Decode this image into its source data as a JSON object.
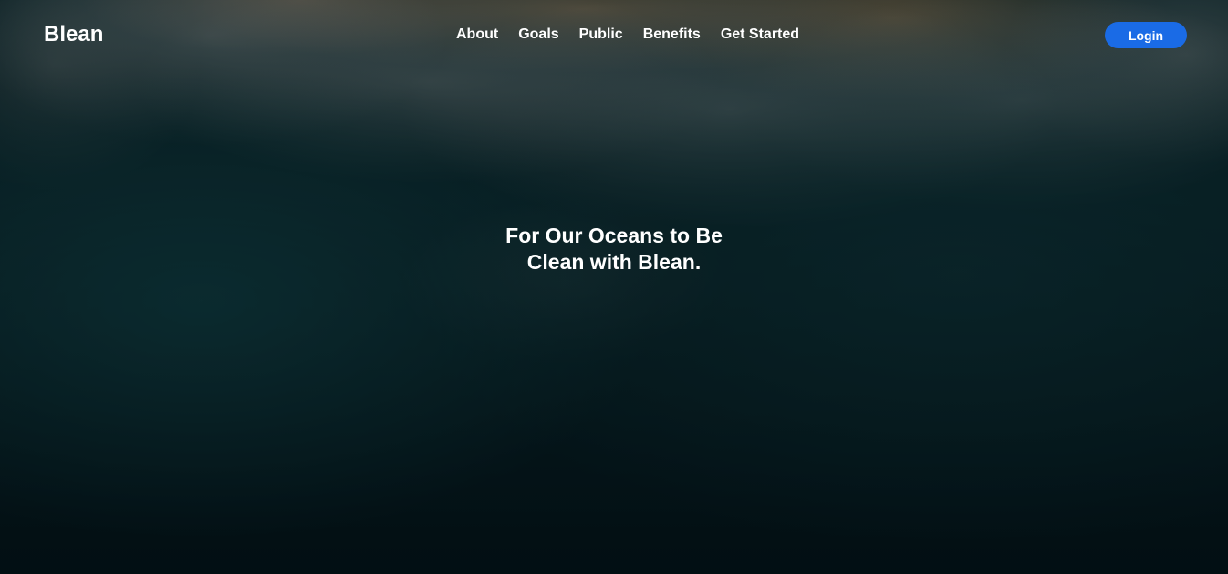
{
  "brand": {
    "logo_text": "Blean",
    "accent_color": "#1a6be6"
  },
  "nav": {
    "items": [
      {
        "label": "About"
      },
      {
        "label": "Goals"
      },
      {
        "label": "Public"
      },
      {
        "label": "Benefits"
      },
      {
        "label": "Get Started"
      }
    ]
  },
  "header": {
    "login_label": "Login"
  },
  "hero": {
    "headline": "For Our Oceans to Be Clean with Blean.",
    "background": "aerial-ocean-waves-image"
  }
}
